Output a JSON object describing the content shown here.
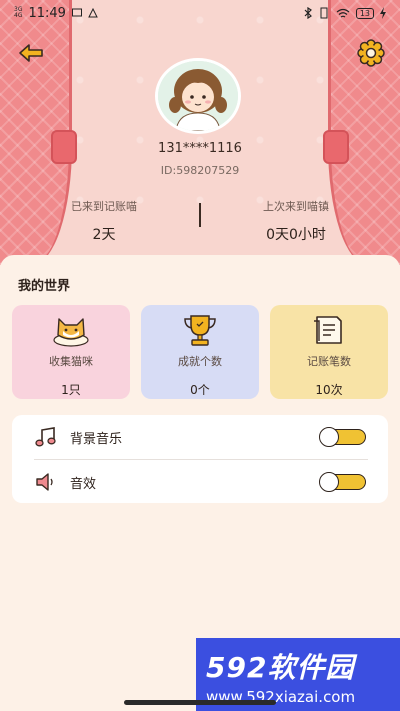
{
  "status_bar": {
    "signal_labels": [
      "3G",
      "4G"
    ],
    "time": "11:49",
    "battery": "13"
  },
  "header": {
    "phone": "131****1116",
    "user_id": "ID:598207529",
    "stats": [
      {
        "label": "已来到记账喵",
        "value": "2天"
      },
      {
        "label": "上次来到喵镇",
        "value": "0天0小时"
      }
    ]
  },
  "world": {
    "title": "我的世界",
    "tiles": [
      {
        "label": "收集猫咪",
        "value": "1只",
        "icon": "cat-icon"
      },
      {
        "label": "成就个数",
        "value": "0个",
        "icon": "trophy-icon"
      },
      {
        "label": "记账笔数",
        "value": "10次",
        "icon": "receipt-icon"
      }
    ]
  },
  "settings": [
    {
      "label": "背景音乐",
      "icon": "music-note-icon",
      "enabled": false
    },
    {
      "label": "音效",
      "icon": "speaker-icon",
      "enabled": false
    }
  ],
  "watermark": {
    "brand": "592软件园",
    "url": "www.592xiazai.com"
  },
  "colors": {
    "header_bg": "#f8d6cf",
    "curtain": "#f08a8c",
    "tile_pink": "#f9d3dd",
    "tile_blue": "#d7dcf5",
    "tile_yellow": "#f8e3a6",
    "toggle_track": "#f0c233",
    "watermark_bg": "#3b4fe0"
  }
}
